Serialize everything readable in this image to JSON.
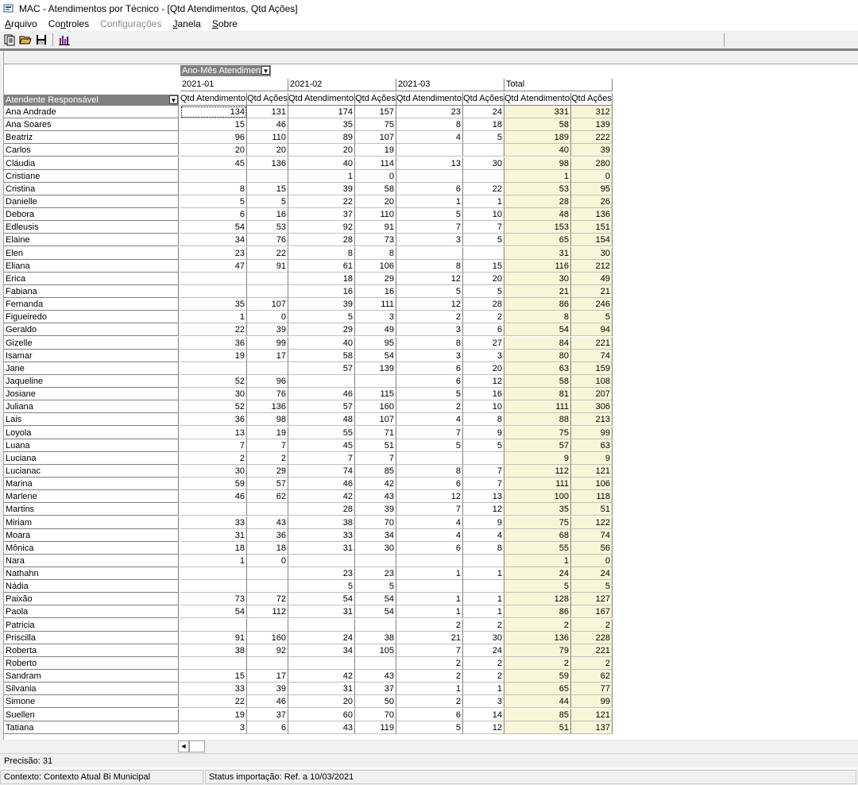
{
  "window": {
    "title": "MAC - Atendimentos por Técnico - [Qtd Atendimentos, Qtd Ações]"
  },
  "menu": [
    {
      "pre": "",
      "u": "A",
      "post": "rquivo",
      "disabled": false
    },
    {
      "pre": "Co",
      "u": "n",
      "post": "troles",
      "disabled": false
    },
    {
      "pre": "Configurações",
      "u": "",
      "post": "",
      "disabled": true
    },
    {
      "pre": "",
      "u": "J",
      "post": "anela",
      "disabled": false
    },
    {
      "pre": "",
      "u": "S",
      "post": "obre",
      "disabled": false
    }
  ],
  "toolbar": {
    "icons": [
      "new-report-icon",
      "open-folder-icon",
      "save-disk-icon",
      "chart-icon"
    ]
  },
  "pivot": {
    "column_field": "Ano-Mês Atendimento",
    "row_field": "Atendente Responsável",
    "periods": [
      "2021-01",
      "2021-02",
      "2021-03",
      "Total"
    ],
    "measures": [
      "Qtd Atendimentos",
      "Qtd Ações"
    ],
    "rows": [
      {
        "name": "Ana Andrade",
        "v": [
          "134",
          "131",
          "174",
          "157",
          "23",
          "24",
          "331",
          "312"
        ]
      },
      {
        "name": "Ana Soares",
        "v": [
          "15",
          "46",
          "35",
          "75",
          "8",
          "18",
          "58",
          "139"
        ]
      },
      {
        "name": "Beatriz",
        "v": [
          "96",
          "110",
          "89",
          "107",
          "4",
          "5",
          "189",
          "222"
        ]
      },
      {
        "name": "Carlos",
        "v": [
          "20",
          "20",
          "20",
          "19",
          "",
          "",
          "40",
          "39"
        ]
      },
      {
        "name": "Cláudia",
        "v": [
          "45",
          "136",
          "40",
          "114",
          "13",
          "30",
          "98",
          "280"
        ]
      },
      {
        "name": "Cristiane",
        "v": [
          "",
          "",
          "1",
          "0",
          "",
          "",
          "1",
          "0"
        ]
      },
      {
        "name": "Cristina",
        "v": [
          "8",
          "15",
          "39",
          "58",
          "6",
          "22",
          "53",
          "95"
        ]
      },
      {
        "name": "Danielle",
        "v": [
          "5",
          "5",
          "22",
          "20",
          "1",
          "1",
          "28",
          "26"
        ]
      },
      {
        "name": "Debora",
        "v": [
          "6",
          "16",
          "37",
          "110",
          "5",
          "10",
          "48",
          "136"
        ]
      },
      {
        "name": "Edleusis",
        "v": [
          "54",
          "53",
          "92",
          "91",
          "7",
          "7",
          "153",
          "151"
        ]
      },
      {
        "name": "Elaine",
        "v": [
          "34",
          "76",
          "28",
          "73",
          "3",
          "5",
          "65",
          "154"
        ]
      },
      {
        "name": "Elen",
        "v": [
          "23",
          "22",
          "8",
          "8",
          "",
          "",
          "31",
          "30"
        ]
      },
      {
        "name": "Eliana",
        "v": [
          "47",
          "91",
          "61",
          "106",
          "8",
          "15",
          "116",
          "212"
        ]
      },
      {
        "name": "Erica",
        "v": [
          "",
          "",
          "18",
          "29",
          "12",
          "20",
          "30",
          "49"
        ]
      },
      {
        "name": "Fabiana",
        "v": [
          "",
          "",
          "16",
          "16",
          "5",
          "5",
          "21",
          "21"
        ]
      },
      {
        "name": "Fernanda",
        "v": [
          "35",
          "107",
          "39",
          "111",
          "12",
          "28",
          "86",
          "246"
        ]
      },
      {
        "name": "Figueiredo",
        "v": [
          "1",
          "0",
          "5",
          "3",
          "2",
          "2",
          "8",
          "5"
        ]
      },
      {
        "name": "Geraldo",
        "v": [
          "22",
          "39",
          "29",
          "49",
          "3",
          "6",
          "54",
          "94"
        ]
      },
      {
        "name": "Gizelle",
        "v": [
          "36",
          "99",
          "40",
          "95",
          "8",
          "27",
          "84",
          "221"
        ]
      },
      {
        "name": "Isamar",
        "v": [
          "19",
          "17",
          "58",
          "54",
          "3",
          "3",
          "80",
          "74"
        ]
      },
      {
        "name": "Jane",
        "v": [
          "",
          "",
          "57",
          "139",
          "6",
          "20",
          "63",
          "159"
        ]
      },
      {
        "name": "Jaqueline",
        "v": [
          "52",
          "96",
          "",
          "",
          "6",
          "12",
          "58",
          "108"
        ]
      },
      {
        "name": "Josiane",
        "v": [
          "30",
          "76",
          "46",
          "115",
          "5",
          "16",
          "81",
          "207"
        ]
      },
      {
        "name": "Juliana",
        "v": [
          "52",
          "136",
          "57",
          "160",
          "2",
          "10",
          "111",
          "306"
        ]
      },
      {
        "name": "Lais",
        "v": [
          "36",
          "98",
          "48",
          "107",
          "4",
          "8",
          "88",
          "213"
        ]
      },
      {
        "name": "Loyola",
        "v": [
          "13",
          "19",
          "55",
          "71",
          "7",
          "9",
          "75",
          "99"
        ]
      },
      {
        "name": "Luana",
        "v": [
          "7",
          "7",
          "45",
          "51",
          "5",
          "5",
          "57",
          "63"
        ]
      },
      {
        "name": "Luciana",
        "v": [
          "2",
          "2",
          "7",
          "7",
          "",
          "",
          "9",
          "9"
        ]
      },
      {
        "name": "Lucianac",
        "v": [
          "30",
          "29",
          "74",
          "85",
          "8",
          "7",
          "112",
          "121"
        ]
      },
      {
        "name": "Marina",
        "v": [
          "59",
          "57",
          "46",
          "42",
          "6",
          "7",
          "111",
          "106"
        ]
      },
      {
        "name": "Marlene",
        "v": [
          "46",
          "62",
          "42",
          "43",
          "12",
          "13",
          "100",
          "118"
        ]
      },
      {
        "name": "Martins",
        "v": [
          "",
          "",
          "28",
          "39",
          "7",
          "12",
          "35",
          "51"
        ]
      },
      {
        "name": "Miriam",
        "v": [
          "33",
          "43",
          "38",
          "70",
          "4",
          "9",
          "75",
          "122"
        ]
      },
      {
        "name": "Moara",
        "v": [
          "31",
          "36",
          "33",
          "34",
          "4",
          "4",
          "68",
          "74"
        ]
      },
      {
        "name": "Mônica",
        "v": [
          "18",
          "18",
          "31",
          "30",
          "6",
          "8",
          "55",
          "56"
        ]
      },
      {
        "name": "Nara",
        "v": [
          "1",
          "0",
          "",
          "",
          "",
          "",
          "1",
          "0"
        ]
      },
      {
        "name": "Nathahn",
        "v": [
          "",
          "",
          "23",
          "23",
          "1",
          "1",
          "24",
          "24"
        ]
      },
      {
        "name": "Nádia",
        "v": [
          "",
          "",
          "5",
          "5",
          "",
          "",
          "5",
          "5"
        ]
      },
      {
        "name": "Paixão",
        "v": [
          "73",
          "72",
          "54",
          "54",
          "1",
          "1",
          "128",
          "127"
        ]
      },
      {
        "name": "Paola",
        "v": [
          "54",
          "112",
          "31",
          "54",
          "1",
          "1",
          "86",
          "167"
        ]
      },
      {
        "name": "Patricia",
        "v": [
          "",
          "",
          "",
          "",
          "2",
          "2",
          "2",
          "2"
        ]
      },
      {
        "name": "Priscilla",
        "v": [
          "91",
          "160",
          "24",
          "38",
          "21",
          "30",
          "136",
          "228"
        ]
      },
      {
        "name": "Roberta",
        "v": [
          "38",
          "92",
          "34",
          "105",
          "7",
          "24",
          "79",
          "221"
        ]
      },
      {
        "name": "Roberto",
        "v": [
          "",
          "",
          "",
          "",
          "2",
          "2",
          "2",
          "2"
        ]
      },
      {
        "name": "Sandram",
        "v": [
          "15",
          "17",
          "42",
          "43",
          "2",
          "2",
          "59",
          "62"
        ]
      },
      {
        "name": "Silvania",
        "v": [
          "33",
          "39",
          "31",
          "37",
          "1",
          "1",
          "65",
          "77"
        ]
      },
      {
        "name": "Simone",
        "v": [
          "22",
          "46",
          "20",
          "50",
          "2",
          "3",
          "44",
          "99"
        ]
      },
      {
        "name": "Suellen",
        "v": [
          "19",
          "37",
          "60",
          "70",
          "6",
          "14",
          "85",
          "121"
        ]
      },
      {
        "name": "Tatiana",
        "v": [
          "3",
          "6",
          "43",
          "119",
          "5",
          "12",
          "51",
          "137"
        ]
      }
    ]
  },
  "status": {
    "precision": "Precisão: 31",
    "context": "Contexto: Contexto Atual Bi Municipal",
    "import": "Status importação: Ref. a 10/03/2021"
  },
  "colors": {
    "total_bg": "#f7f7d8",
    "field_bg": "#808080"
  }
}
